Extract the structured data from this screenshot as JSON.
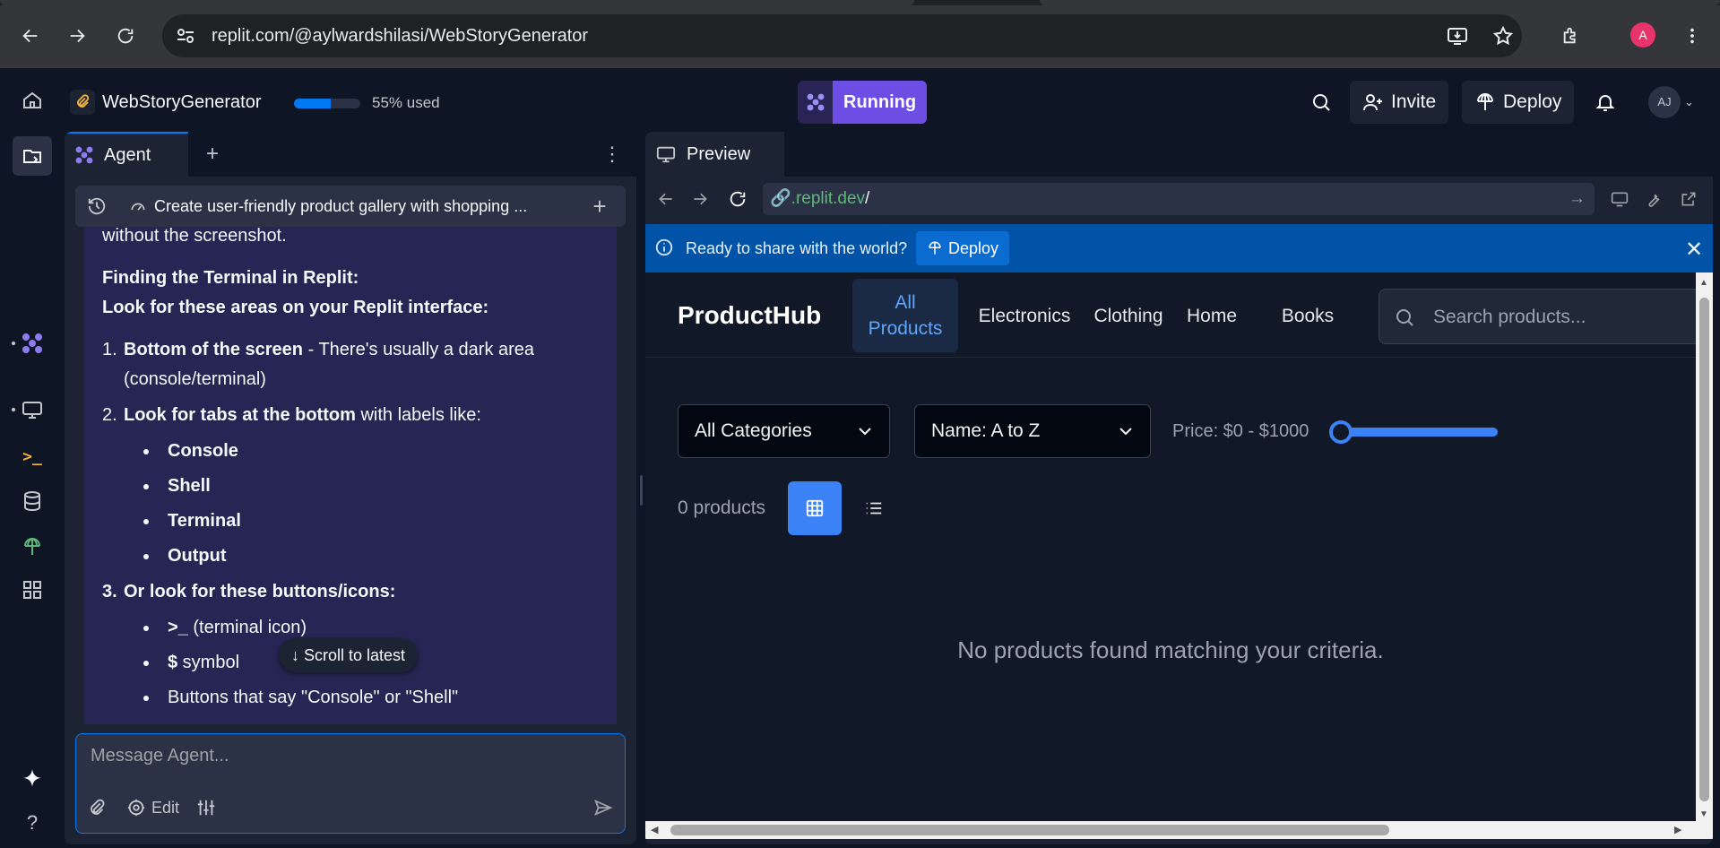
{
  "browser": {
    "url": "replit.com/@aylwardshilasi/WebStoryGenerator",
    "profile_initial": "A"
  },
  "workspace": {
    "project_name": "WebStoryGenerator",
    "usage_percent": 55,
    "usage_label": "55% used",
    "run_label": "Running",
    "invite_label": "Invite",
    "deploy_label": "Deploy",
    "avatar_initials": "AJ"
  },
  "agent": {
    "tab_label": "Agent",
    "thread_title": "Create user-friendly product gallery with shopping ...",
    "message": {
      "line_intro": "without the screenshot.",
      "heading_1": "Finding the Terminal in Replit:",
      "heading_2": "Look for these areas on your Replit interface:",
      "item1_num": "1.",
      "item1_bold": "Bottom of the screen",
      "item1_rest": " - There's usually a dark area",
      "item1_cont": "(console/terminal)",
      "item2_num": "2.",
      "item2_bold": "Look for tabs at the bottom",
      "item2_rest": " with labels like:",
      "tabs": [
        "Console",
        "Shell",
        "Terminal",
        "Output"
      ],
      "item3_num": "3.",
      "item3_bold": "Or look for these buttons/icons:",
      "icon1_bold": ">_",
      "icon1_rest": " (terminal icon)",
      "icon2_bold": "$",
      "icon2_rest": " symbol",
      "cut_line": "Buttons that say \"Console\" or \"Shell\""
    },
    "scroll_label": "Scroll to latest",
    "composer_placeholder": "Message Agent...",
    "edit_label": "Edit"
  },
  "preview": {
    "tab_label": "Preview",
    "url_domain": ".replit.dev",
    "url_path": "/",
    "banner_text": "Ready to share with the world?",
    "banner_deploy": "Deploy"
  },
  "site": {
    "brand": "ProductHub",
    "nav": [
      "All Products",
      "Electronics",
      "Clothing",
      "Home",
      "Books"
    ],
    "search_placeholder": "Search products...",
    "category_filter": "All Categories",
    "sort_filter": "Name: A to Z",
    "price_label": "Price: $0 - $1000",
    "price_min": 0,
    "price_max": 1000,
    "product_count": "0 products",
    "empty_message": "No products found matching your criteria."
  },
  "colors": {
    "accent": "#0079f2",
    "running": "#6c4ee4",
    "banner": "#0053a6",
    "site_primary": "#3b82f6"
  }
}
